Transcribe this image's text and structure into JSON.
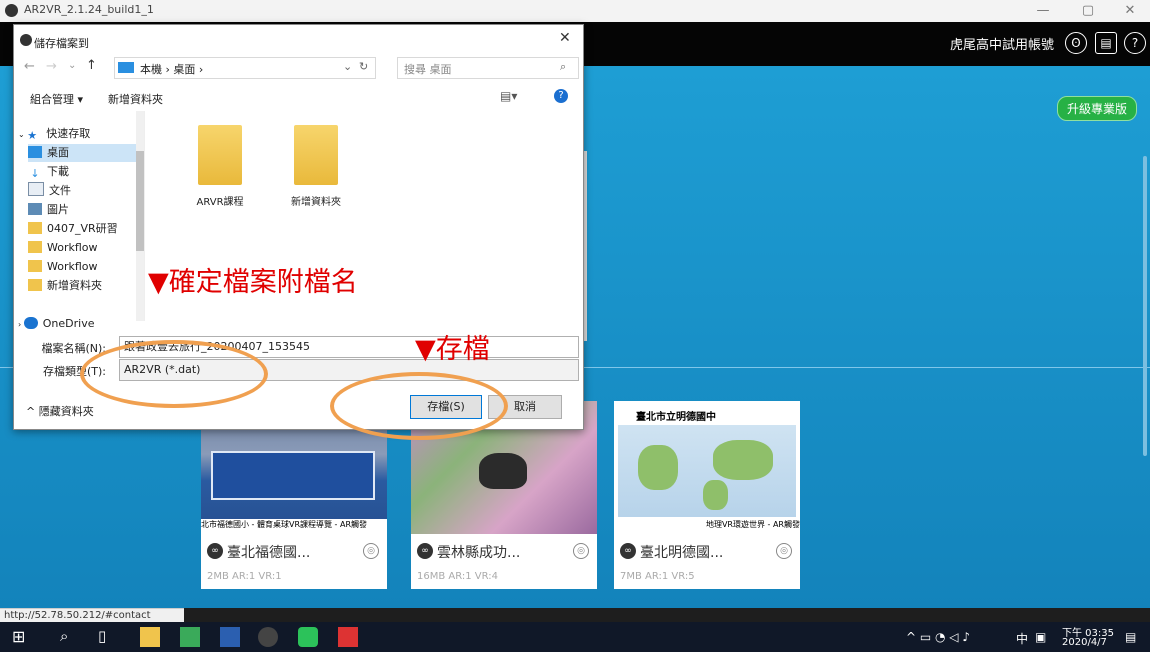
{
  "window": {
    "title": "AR2VR_2.1.24_build1_1",
    "min_glyph": "—",
    "max_glyph": "▢",
    "close_glyph": "✕"
  },
  "header": {
    "account": "虎尾高中試用帳號",
    "user_icon": "user-icon",
    "book_icon": "book-icon",
    "help_icon": "help-icon",
    "upgrade": "升級專業版"
  },
  "dialog": {
    "title": "儲存檔案到",
    "close_glyph": "✕",
    "breadcrumb": "本機 › 桌面 ›",
    "search_placeholder": "搜尋 桌面",
    "organize": "組合管理 ▾",
    "new_folder": "新增資料夾",
    "nav_items": [
      "快速存取",
      "桌面",
      "下載",
      "文件",
      "圖片",
      "0407_VR研習",
      "Workflow",
      "Workflow",
      "新增資料夾",
      "OneDrive"
    ],
    "files": [
      "ARVR課程",
      "新增資料夾"
    ],
    "filename_label": "檔案名稱(N):",
    "filename_value": "跟著政壹去旅行_20200407_153545",
    "filetype_label": "存檔類型(T):",
    "filetype_value": "AR2VR (*.dat)",
    "hide_folders": "隱藏資料夾",
    "save_button": "存檔(S)",
    "cancel_button": "取消"
  },
  "annotations": {
    "confirm_ext": "▼確定檔案附檔名",
    "save": "▼存檔"
  },
  "cards": [
    {
      "caption": "北市福德國小 - 體育桌球VR課程導覽 - AR觸發",
      "title": "臺北福德國...",
      "info": "2MB AR:1 VR:1"
    },
    {
      "caption": "",
      "title": "雲林縣成功...",
      "info": "16MB AR:1 VR:4"
    },
    {
      "caption": "地理VR環遊世界 - AR觸發",
      "title": "臺北明德國...",
      "info": "7MB AR:1 VR:5",
      "banner": "臺北市立明德國中"
    }
  ],
  "status_url": "http://52.78.50.212/#contact",
  "tray": {
    "ime": "中",
    "time": "下午 03:35",
    "date": "2020/4/7"
  },
  "colors": {
    "app_blue": "#1e9ed4",
    "upgrade_green": "#27b145",
    "annotation_red": "#e00000",
    "ellipse_orange": "#f0a050"
  }
}
